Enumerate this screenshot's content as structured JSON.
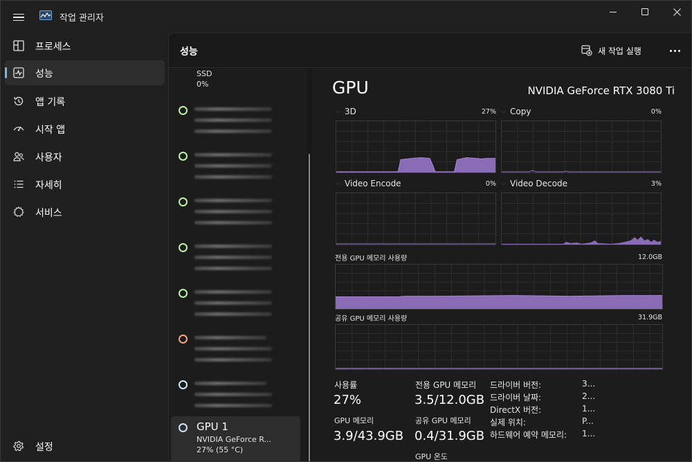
{
  "app": {
    "title": "작업 관리자"
  },
  "sidebar": {
    "items": [
      {
        "label": "프로세스",
        "icon": "processes-icon"
      },
      {
        "label": "성능",
        "icon": "performance-icon",
        "active": true
      },
      {
        "label": "앱 기록",
        "icon": "history-icon"
      },
      {
        "label": "시작 앱",
        "icon": "startup-icon"
      },
      {
        "label": "사용자",
        "icon": "users-icon"
      },
      {
        "label": "자세히",
        "icon": "details-icon"
      },
      {
        "label": "서비스",
        "icon": "services-icon"
      }
    ],
    "settings_label": "설정"
  },
  "header": {
    "title": "성능",
    "run_task_label": "새 작업 실행"
  },
  "device_list": {
    "ssd_name": "SSD",
    "ssd_value": "0%",
    "gpu1": {
      "name": "GPU 1",
      "model": "NVIDIA GeForce R...",
      "value": "27% (55 °C)"
    }
  },
  "detail": {
    "title": "GPU",
    "model": "NVIDIA GeForce RTX 3080 Ti",
    "graphs": {
      "g3d": {
        "label": "3D",
        "pct": "27%"
      },
      "copy": {
        "label": "Copy",
        "pct": "0%"
      },
      "video_encode": {
        "label": "Video Encode",
        "pct": "0%"
      },
      "video_decode": {
        "label": "Video Decode",
        "pct": "3%"
      },
      "dedicated": {
        "label": "전용 GPU 메모리 사용량",
        "max": "12.0GB"
      },
      "shared": {
        "label": "공유 GPU 메모리 사용량",
        "max": "31.9GB"
      }
    },
    "stats": {
      "utilization_label": "사용률",
      "utilization_value": "27%",
      "dedicated_label": "전용 GPU 메모리",
      "dedicated_value": "3.5/12.0GB",
      "gpu_memory_label": "GPU 메모리",
      "gpu_memory_value": "3.9/43.9GB",
      "shared_label": "공유 GPU 메모리",
      "shared_value": "0.4/31.9GB",
      "temp_label": "GPU 온도"
    },
    "info": [
      {
        "label": "드라이버 버전:",
        "value": "3..."
      },
      {
        "label": "드라이버 날짜:",
        "value": "2..."
      },
      {
        "label": "DirectX 버전:",
        "value": "1..."
      },
      {
        "label": "실제 위치:",
        "value": "P..."
      },
      {
        "label": "하드웨어 예약 메모리:",
        "value": "1..."
      }
    ]
  },
  "colors": {
    "accent": "#76b9ed",
    "graph_fill": "#8a6bb5",
    "graph_line": "#a889d6",
    "status_dot_green": "#bdf3a2",
    "status_dot_orange": "#f0a77a",
    "status_dot_blue": "#cfe8ff"
  }
}
